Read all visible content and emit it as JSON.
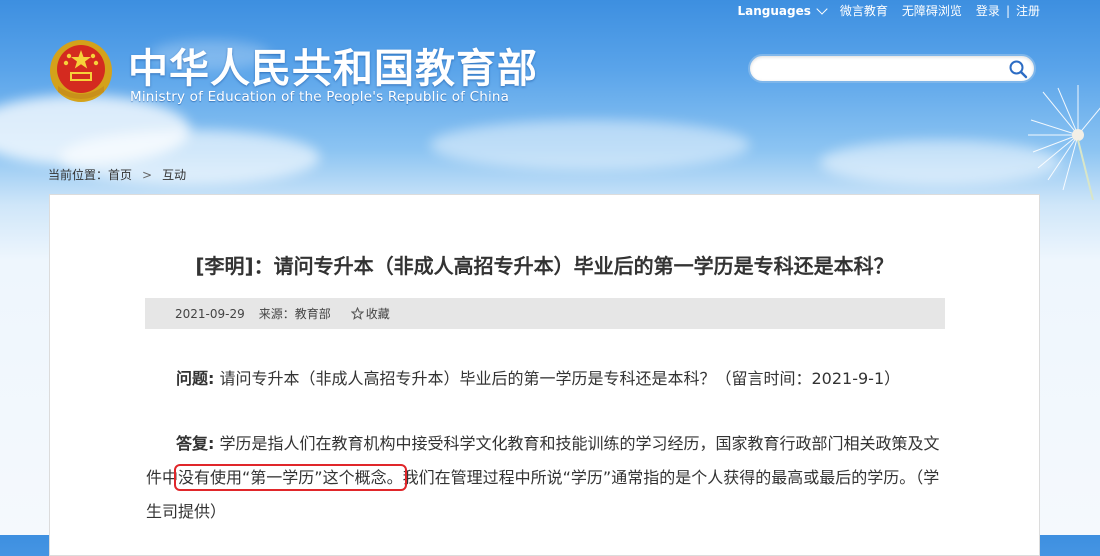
{
  "topbar": {
    "languages": "Languages",
    "weibo": "微言教育",
    "accessible": "无障碍浏览",
    "login": "登录",
    "separator": "|",
    "register": "注册"
  },
  "header": {
    "title": "中华人民共和国教育部",
    "subtitle": "Ministry of Education of the People's Republic of China"
  },
  "search": {
    "placeholder": "",
    "value": ""
  },
  "breadcrumb": {
    "prefix": "当前位置：",
    "home": "首页",
    "arrow": ">",
    "current": "互动"
  },
  "article": {
    "title": "[李明]：请问专升本（非成人高招专升本）毕业后的第一学历是专科还是本科？",
    "date": "2021-09-29",
    "source_label": "来源：教育部",
    "favorite": "收藏",
    "question_label": "问题:",
    "question_text": " 请问专升本（非成人高招专升本）毕业后的第一学历是专科还是本科？（留言时间：2021-9-1）",
    "answer_label": "答复:",
    "answer_text_1": " 学历是指人们在教育机构中接受科学文化教育和技能训练的学习经历，国家教育行政部门相关政策及文件中",
    "answer_highlight": "没有使用“第一学历”这个概念。",
    "answer_text_2": "我们在管理过程中所说“学历”通常指的是个人获得的最高或最后的学历。（学生司提供）"
  },
  "colors": {
    "highlight": "#e0262a",
    "meta_bg": "#e6e6e6"
  }
}
